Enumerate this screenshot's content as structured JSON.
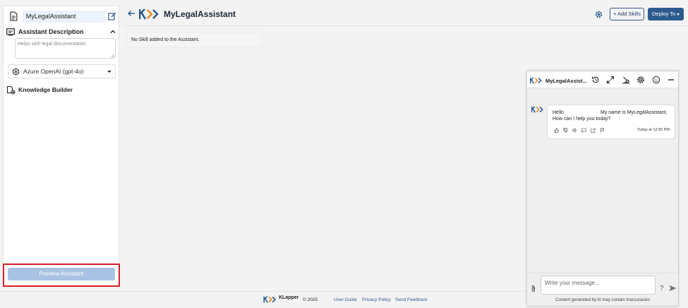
{
  "sidebar": {
    "assistant_name": "MyLegalAssistant",
    "description_heading": "Assistant Description",
    "description_value": "Helps with legal documentation",
    "model_selected": "Azure OpenAI (gpt-4o)",
    "knowledge_builder": "Knowledge Builder",
    "preview_button": "Preview Assistant"
  },
  "header": {
    "title": "MyLegalAssistant",
    "add_skills": "+ Add Skills",
    "deploy": "Deploy To"
  },
  "main": {
    "empty_message": "No Skill added to the Assistant."
  },
  "chat": {
    "title": "MyLegalAssist...",
    "greeting_part1": "Hello",
    "greeting_part2": "My name is MyLegalAssistant,",
    "greeting_line2": "How can I help you today?",
    "timestamp": "Today at 12:55 PM",
    "input_placeholder": "Write your message...",
    "help": "?",
    "disclaimer": "Content generated by AI may contain inaccuracies"
  },
  "footer": {
    "brand": "KLapper",
    "copyright": "© 2025",
    "links": [
      "User Guide",
      "Privacy Policy",
      "Send Feedback"
    ]
  },
  "colors": {
    "brand_blue": "#2c5a8f",
    "brand_orange": "#f08a24",
    "highlight_red": "#d81f26",
    "preview_disabled": "#a9c2e3"
  }
}
